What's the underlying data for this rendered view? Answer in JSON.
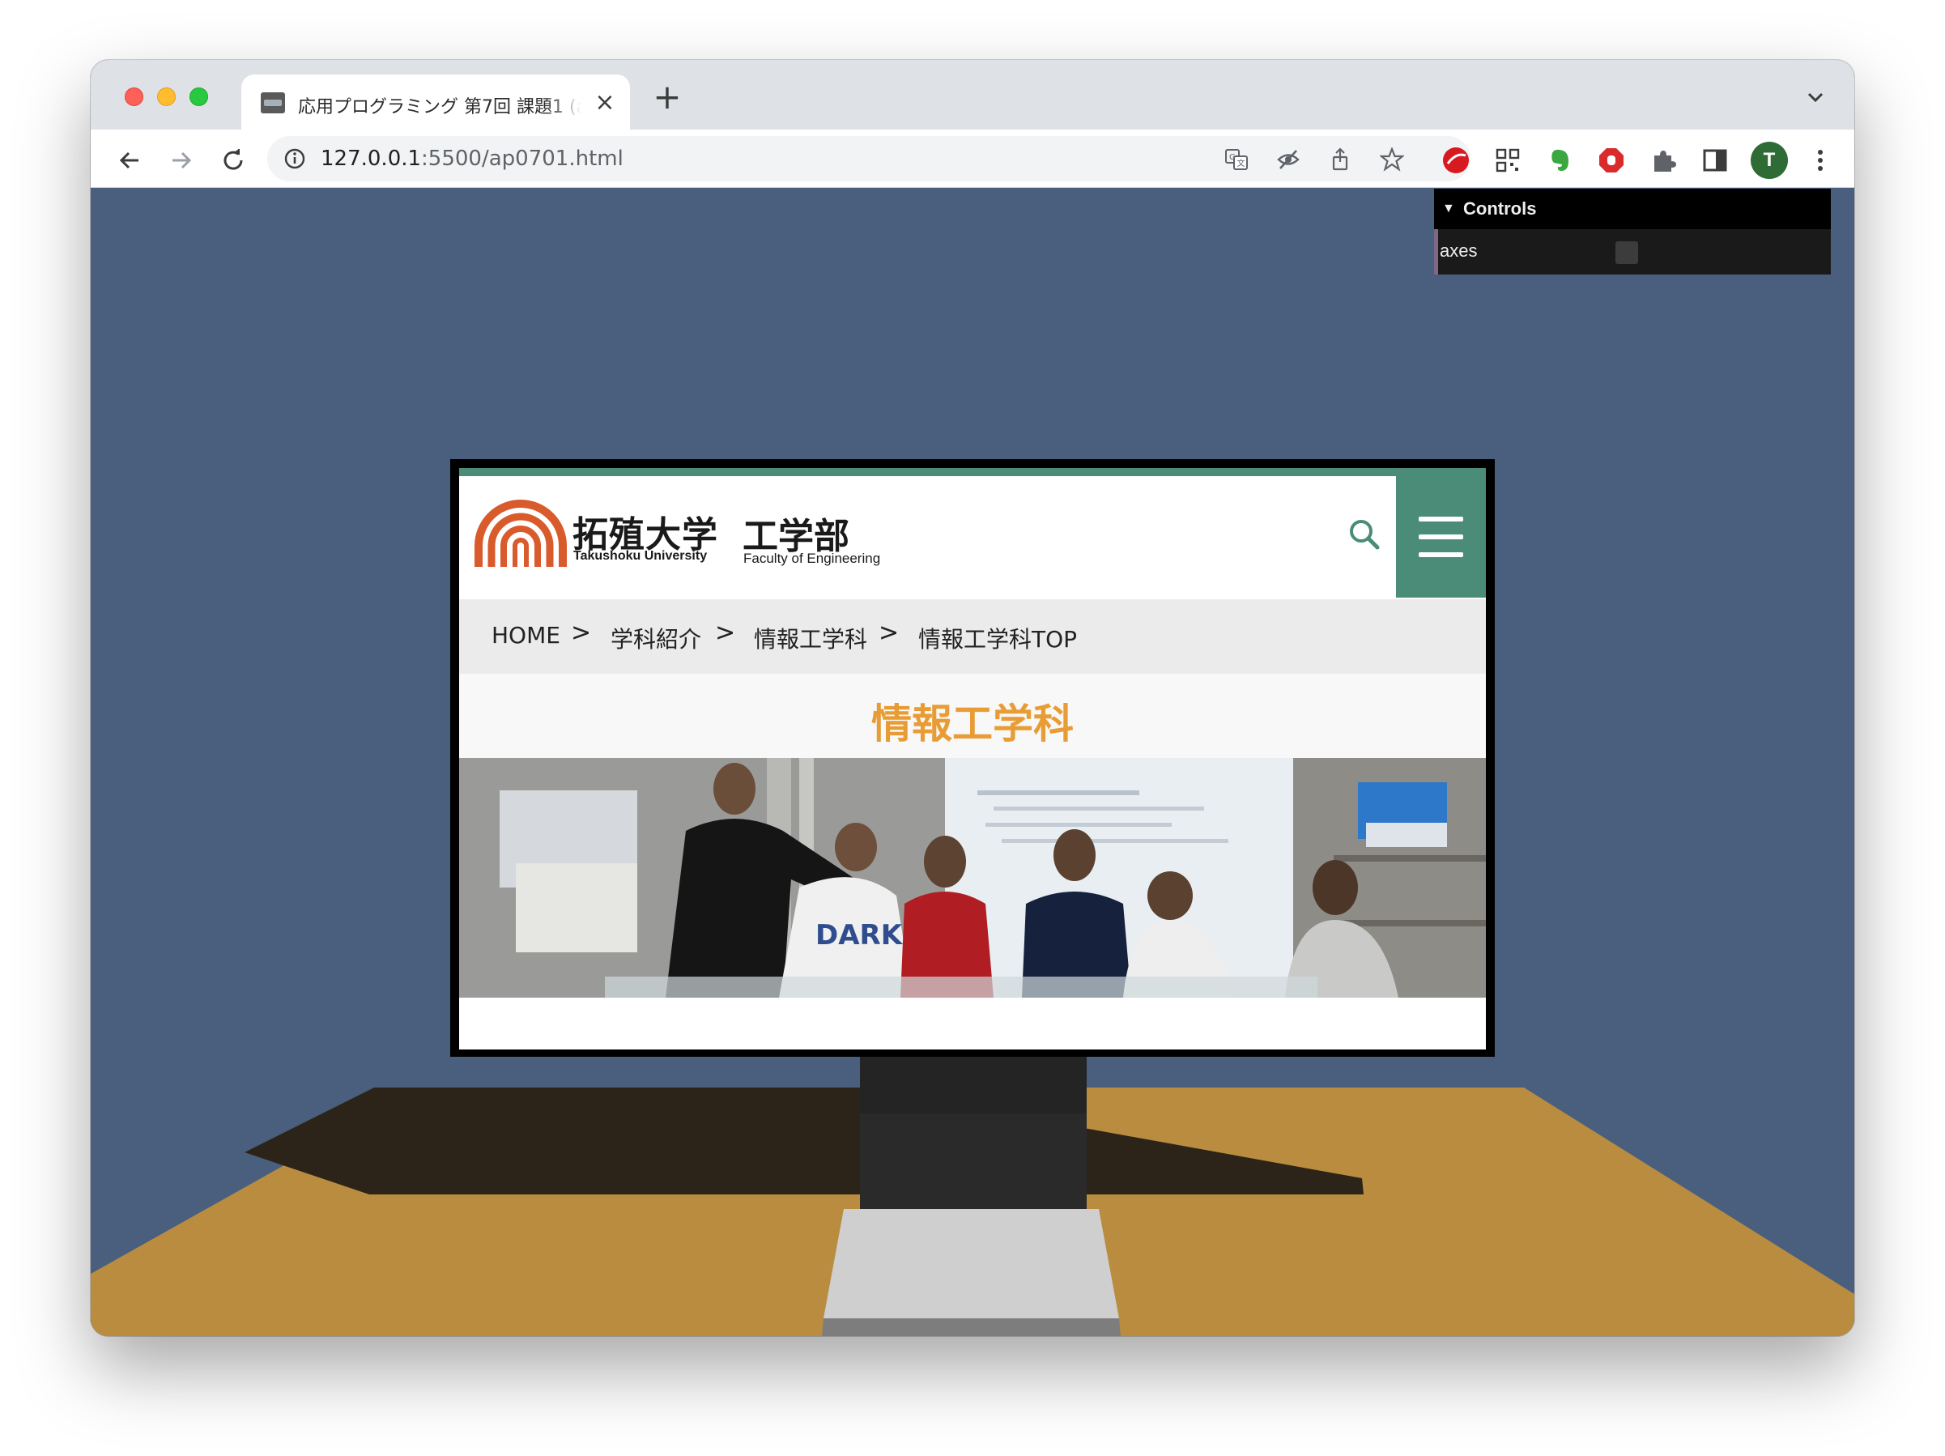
{
  "browser": {
    "tab_title": "応用プログラミング 第7回 課題1 (a",
    "url_host": "127.0.0.1",
    "url_rest": ":5500/ap0701.html",
    "profile_initial": "T"
  },
  "gui": {
    "title": "Controls",
    "rows": [
      {
        "label": "axes",
        "checked": false
      }
    ]
  },
  "site": {
    "logo_ja": "拓殖大学",
    "logo_en": "Takushoku University",
    "faculty_ja": "工学部",
    "faculty_en": "Faculty of Engineering",
    "breadcrumbs": [
      "HOME",
      "学科紹介",
      "情報工学科",
      "情報工学科TOP"
    ],
    "breadcrumb_sep": ">",
    "page_title": "情報工学科",
    "accent_color": "#4a8c78",
    "title_color": "#e89c35"
  },
  "scene": {
    "background": "#4a5f7e",
    "table_color": "#b98c40",
    "stand_color": "#2a2a2a"
  }
}
